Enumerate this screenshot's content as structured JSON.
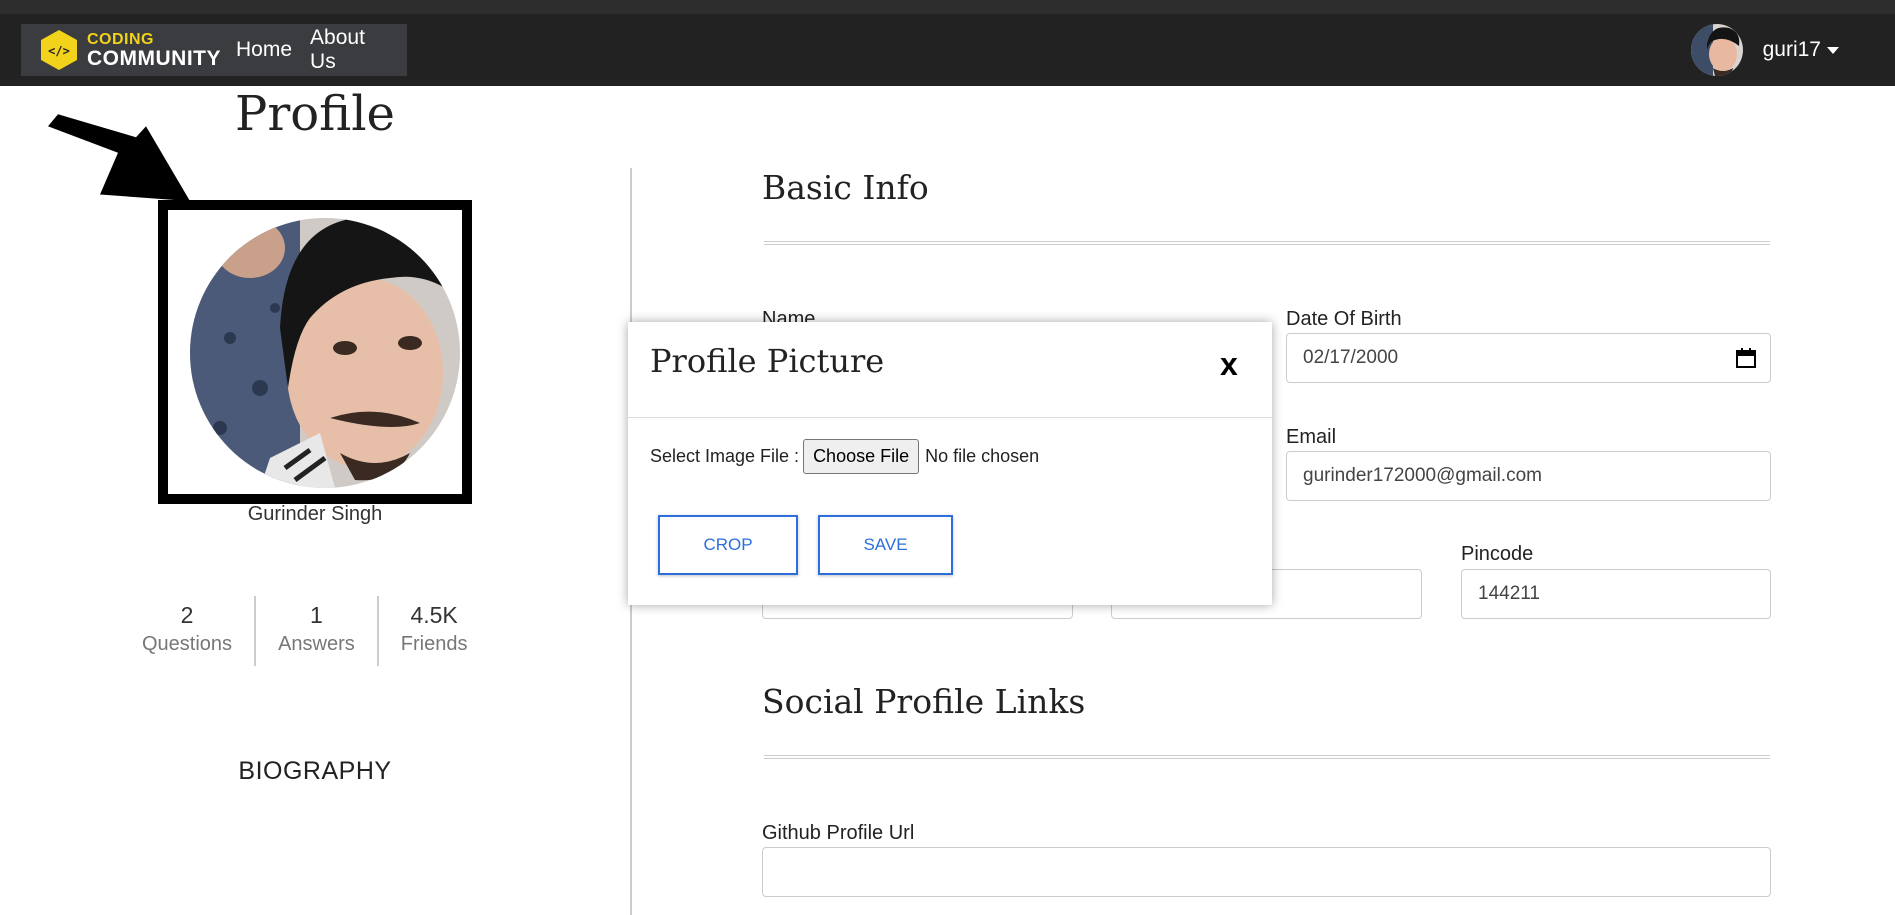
{
  "navbar": {
    "brand_top": "CODING",
    "brand_bottom": "COMMUNITY",
    "links": [
      "Home",
      "About Us"
    ],
    "username": "guri17"
  },
  "profile": {
    "title": "Profile",
    "name": "Gurinder Singh",
    "stats": [
      {
        "value": "2",
        "label": "Questions"
      },
      {
        "value": "1",
        "label": "Answers"
      },
      {
        "value": "4.5K",
        "label": "Friends"
      }
    ],
    "biography_heading": "BIOGRAPHY"
  },
  "basic_info": {
    "title": "Basic Info",
    "name_label": "Name",
    "dob_label": "Date Of Birth",
    "dob_value": "02/17/2000",
    "email_label": "Email",
    "email_value": "gurinder172000@gmail.com",
    "pincode_label": "Pincode",
    "pincode_value": "144211"
  },
  "social": {
    "title": "Social Profile Links",
    "github_label": "Github Profile Url",
    "github_value": ""
  },
  "modal": {
    "title": "Profile Picture",
    "close": "x",
    "select_label": "Select Image File :",
    "choose_button": "Choose File",
    "no_file": "No file chosen",
    "crop_button": "CROP",
    "save_button": "SAVE"
  },
  "colors": {
    "navbar": "#222222",
    "accent_button": "#2c6fdc",
    "brand_yellow": "#f2d21b"
  }
}
